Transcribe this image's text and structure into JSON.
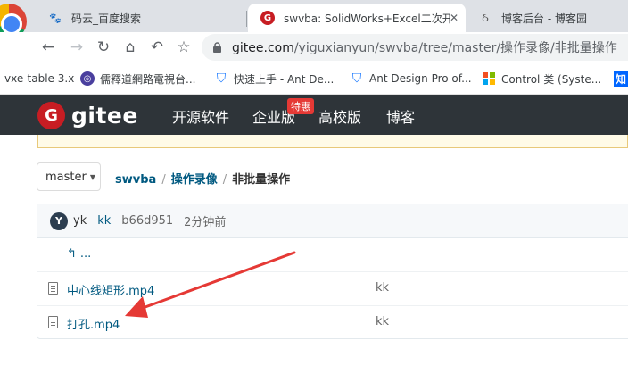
{
  "browser": {
    "tabs": [
      {
        "title": "码云_百度搜索",
        "icon": "paw-icon"
      },
      {
        "title": "swvba: SolidWorks+Excel二次开",
        "icon": "gitee-icon",
        "close": "✕"
      },
      {
        "title": "博客后台 - 博客园",
        "icon": "blog-icon"
      }
    ],
    "url_host": "gitee.com",
    "url_path": "/yiguxianyun/swvba/tree/master/操作录像/非批量操作"
  },
  "bookmarks": [
    {
      "label": "vxe-table 3.x"
    },
    {
      "label": "儒釋道網路電視台..."
    },
    {
      "label": "快速上手 - Ant De..."
    },
    {
      "label": "Ant Design Pro of..."
    },
    {
      "label": "Control 类 (Syste..."
    },
    {
      "label": "知"
    }
  ],
  "gitee": {
    "logo_text": "gitee",
    "nav": [
      "开源软件",
      "企业版",
      "高校版",
      "博客"
    ],
    "badge": "特惠"
  },
  "repo": {
    "branch": "master",
    "breadcrumb": {
      "repo": "swvba",
      "dir": "操作录像",
      "current": "非批量操作"
    }
  },
  "commit": {
    "avatar_letter": "Y",
    "author": "yk",
    "message": "kk",
    "hash": "b66d951",
    "time": "2分钟前"
  },
  "files": {
    "up_label": "...",
    "rows": [
      {
        "name": "中心线矩形.mp4",
        "commit_msg": "kk"
      },
      {
        "name": "打孔.mp4",
        "commit_msg": "kk"
      }
    ]
  },
  "colors": {
    "header_bg": "#2e3439",
    "gitee_red": "#c71d23",
    "link_blue": "#005980",
    "annotation_red": "#e53935"
  }
}
